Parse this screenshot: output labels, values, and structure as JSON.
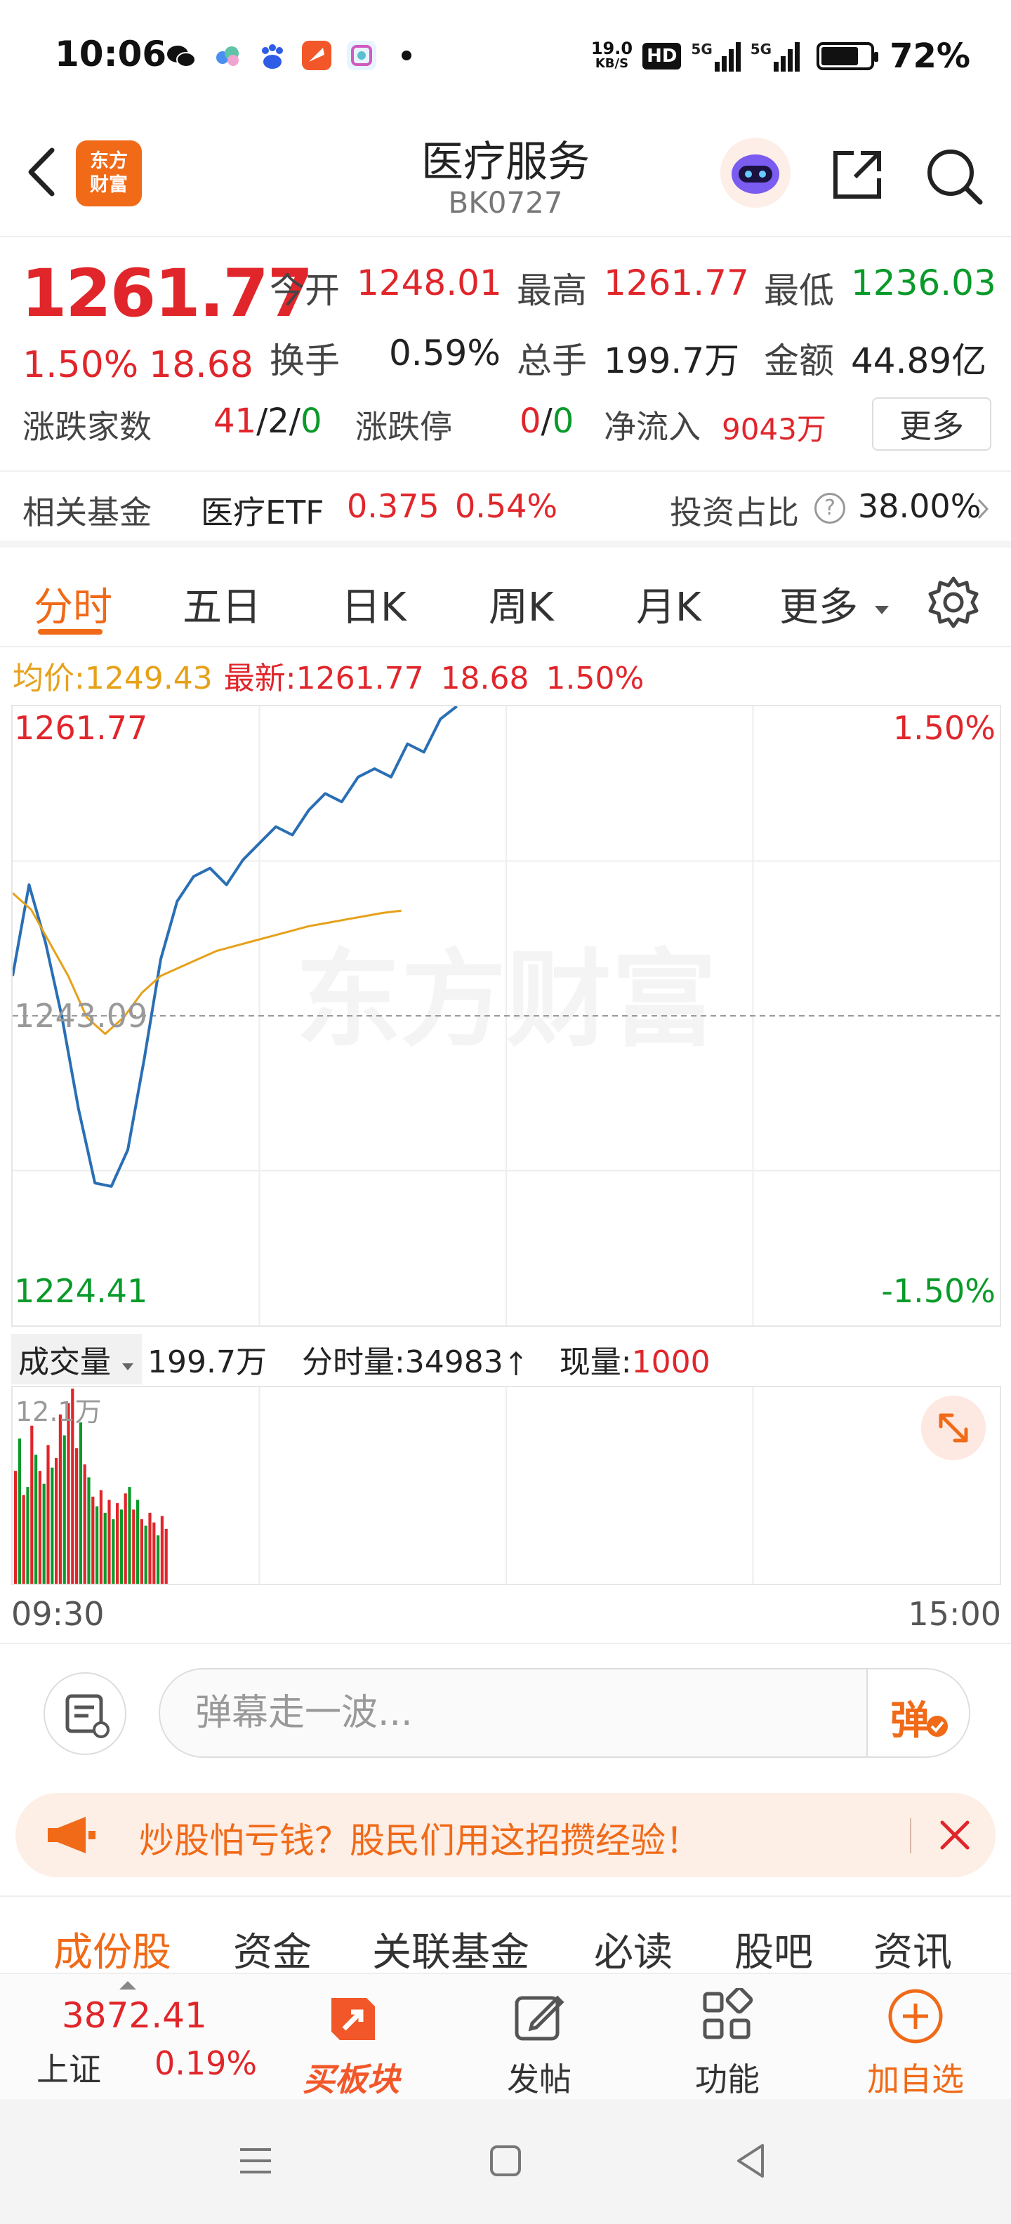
{
  "status_bar": {
    "time": "10:06",
    "net_speed_value": "19.0",
    "net_speed_unit": "KB/S",
    "hd_label": "HD",
    "signal_label_1": "5G",
    "signal_label_2": "5G",
    "battery": "72%"
  },
  "header": {
    "logo_line1": "东方",
    "logo_line2": "财富",
    "title": "医疗服务",
    "code": "BK0727"
  },
  "quote": {
    "last_price": "1261.77",
    "change_pct": "1.50%",
    "change_amt": "18.68",
    "open_label": "今开",
    "open": "1248.01",
    "high_label": "最高",
    "high": "1261.77",
    "low_label": "最低",
    "low": "1236.03",
    "turnover_label": "换手",
    "turnover": "0.59%",
    "total_vol_label": "总手",
    "total_vol": "199.7万",
    "amount_label": "金额",
    "amount": "44.89亿",
    "updown_label": "涨跌家数",
    "up_count": "41",
    "flat_count": "2",
    "down_count": "0",
    "slash": "/",
    "limit_label": "涨跌停",
    "limit_up": "0",
    "limit_down": "0",
    "netflow_label": "净流入",
    "netflow": "9043万",
    "more_label": "更多"
  },
  "fund": {
    "label": "相关基金",
    "name": "医疗ETF",
    "price": "0.375",
    "change": "0.54%",
    "ratio_label": "投资占比",
    "ratio": "38.00%"
  },
  "tabs": [
    "分时",
    "五日",
    "日K",
    "周K",
    "月K",
    "更多"
  ],
  "chart_info": {
    "avg_label": "均价:",
    "avg": "1249.43",
    "latest_label": "最新:",
    "latest": "1261.77",
    "change": "18.68",
    "change_pct": "1.50%"
  },
  "chart_labels": {
    "y_top": "1261.77",
    "y_mid": "1243.09",
    "y_bottom": "1224.41",
    "pct_top": "1.50%",
    "pct_bottom": "-1.50%",
    "watermark": "东方财富",
    "vol_max": "12.1万",
    "time_start": "09:30",
    "time_end": "15:00"
  },
  "volume_info": {
    "dropdown": "成交量",
    "total": "199.7万",
    "minute_label": "分时量:",
    "minute_vol": "34983",
    "current_label": "现量:",
    "current": "1000"
  },
  "chart_data": {
    "type": "line",
    "xlim": [
      "09:30",
      "15:00"
    ],
    "ylim": [
      1224.41,
      1261.77
    ],
    "prev_close": 1243.09,
    "series": [
      {
        "color": "#2a6fb4",
        "values": [
          1245.5,
          1251.0,
          1247.5,
          1243.0,
          1237.5,
          1233.0,
          1232.8,
          1235.0,
          1240.5,
          1246.5,
          1250.0,
          1251.5,
          1252.0,
          1251.0,
          1252.5,
          1253.5,
          1254.5,
          1254.0,
          1255.5,
          1256.5,
          1256.0,
          1257.5,
          1258.0,
          1257.5,
          1259.5,
          1259.0,
          1261.0,
          1261.77
        ]
      },
      {
        "color": "#e6a11a",
        "values": [
          1250.5,
          1249.5,
          1247.5,
          1245.5,
          1243.0,
          1242.0,
          1243.0,
          1244.5,
          1245.5,
          1246.0,
          1246.5,
          1247.0,
          1247.3,
          1247.6,
          1247.9,
          1248.2,
          1248.5,
          1248.7,
          1248.9,
          1249.1,
          1249.3,
          1249.43
        ]
      }
    ],
    "volume": {
      "max": 121000,
      "up_color": "#e0262b",
      "down_color": "#0a9a2a",
      "bars": [
        [
          70000,
          "r"
        ],
        [
          90000,
          "g"
        ],
        [
          55000,
          "r"
        ],
        [
          60000,
          "g"
        ],
        [
          98000,
          "r"
        ],
        [
          80000,
          "g"
        ],
        [
          70000,
          "r"
        ],
        [
          62000,
          "g"
        ],
        [
          86000,
          "r"
        ],
        [
          72000,
          "g"
        ],
        [
          78000,
          "r"
        ],
        [
          105000,
          "r"
        ],
        [
          92000,
          "g"
        ],
        [
          112000,
          "r"
        ],
        [
          121000,
          "r"
        ],
        [
          84000,
          "r"
        ],
        [
          100000,
          "g"
        ],
        [
          74000,
          "r"
        ],
        [
          66000,
          "g"
        ],
        [
          54000,
          "r"
        ],
        [
          48000,
          "g"
        ],
        [
          58000,
          "r"
        ],
        [
          44000,
          "g"
        ],
        [
          52000,
          "r"
        ],
        [
          40000,
          "g"
        ],
        [
          50000,
          "r"
        ],
        [
          46000,
          "g"
        ],
        [
          56000,
          "r"
        ],
        [
          60000,
          "g"
        ],
        [
          46000,
          "r"
        ],
        [
          52000,
          "g"
        ],
        [
          40000,
          "r"
        ],
        [
          36000,
          "g"
        ],
        [
          44000,
          "r"
        ],
        [
          38000,
          "r"
        ],
        [
          30000,
          "g"
        ],
        [
          42000,
          "r"
        ],
        [
          34000,
          "r"
        ]
      ]
    }
  },
  "danmaku": {
    "placeholder": "弹幕走一波...",
    "send_label": "弹"
  },
  "promo": {
    "text": "炒股怕亏钱？股民们用这招攒经验！"
  },
  "section_tabs": [
    "成份股",
    "资金",
    "关联基金",
    "必读",
    "股吧",
    "资讯"
  ],
  "bottom_nav": {
    "index_value": "3872.41",
    "index_name": "上证",
    "index_change": "0.19%",
    "buy_label": "买板块",
    "post_label": "发帖",
    "func_label": "功能",
    "add_label": "加自选"
  }
}
